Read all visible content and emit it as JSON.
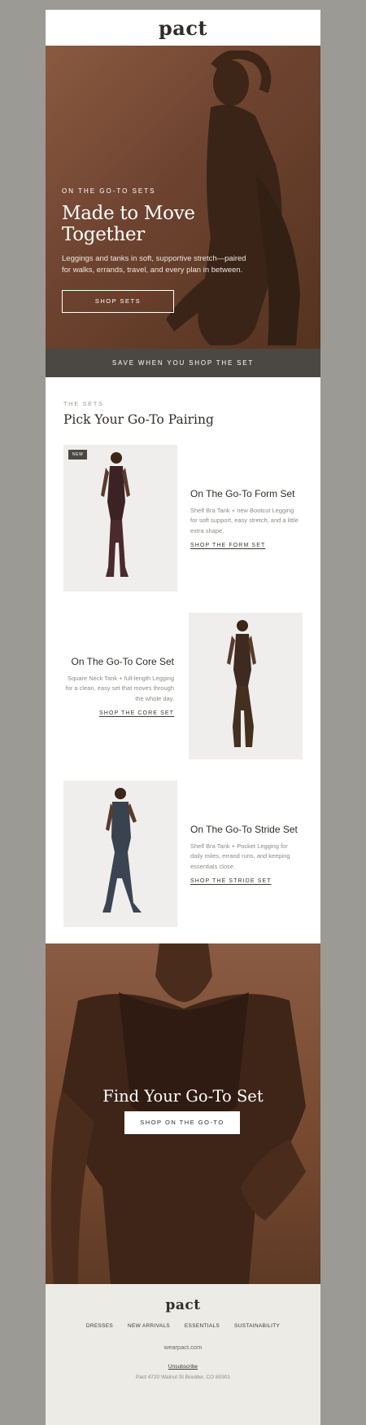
{
  "brand": {
    "logo": "pact"
  },
  "hero": {
    "eyebrow": "ON THE GO-TO SETS",
    "title": "Made to Move Together",
    "copy": "Leggings and tanks in soft, supportive stretch—paired for walks, errands, travel, and every plan in between.",
    "cta": "SHOP SETS"
  },
  "banner": {
    "text": "SAVE WHEN YOU SHOP THE SET"
  },
  "sets": {
    "eyebrow": "THE SETS",
    "title": "Pick Your Go-To Pairing",
    "items": [
      {
        "badge": "NEW",
        "name": "On The Go-To Form Set",
        "desc": "Shelf Bra Tank + new Bootcut Legging for soft support, easy stretch, and a little extra shape.",
        "link": "SHOP THE FORM SET"
      },
      {
        "name": "On The Go-To Core Set",
        "desc": "Square Neck Tank + full-length Legging for a clean, easy set that moves through the whole day.",
        "link": "SHOP THE CORE SET"
      },
      {
        "name": "On The Go-To Stride Set",
        "desc": "Shelf Bra Tank + Pocket Legging for daily miles, errand runs, and keeping essentials close.",
        "link": "SHOP THE STRIDE SET"
      }
    ]
  },
  "final": {
    "title": "Find Your Go-To Set",
    "cta": "SHOP ON THE GO-TO"
  },
  "footer": {
    "logo": "pact",
    "nav": [
      "DRESSES",
      "NEW ARRIVALS",
      "ESSENTIALS",
      "SUSTAINABILITY"
    ],
    "site": "wearpact.com",
    "unsubscribe": "Unsubscribe",
    "address": "Pact 4720 Walnut St Boulder, CO 80301"
  },
  "colors": {
    "accent_dark": "#4b4843",
    "hero_brown": "#6d4330",
    "footer_bg": "#edebe6"
  }
}
